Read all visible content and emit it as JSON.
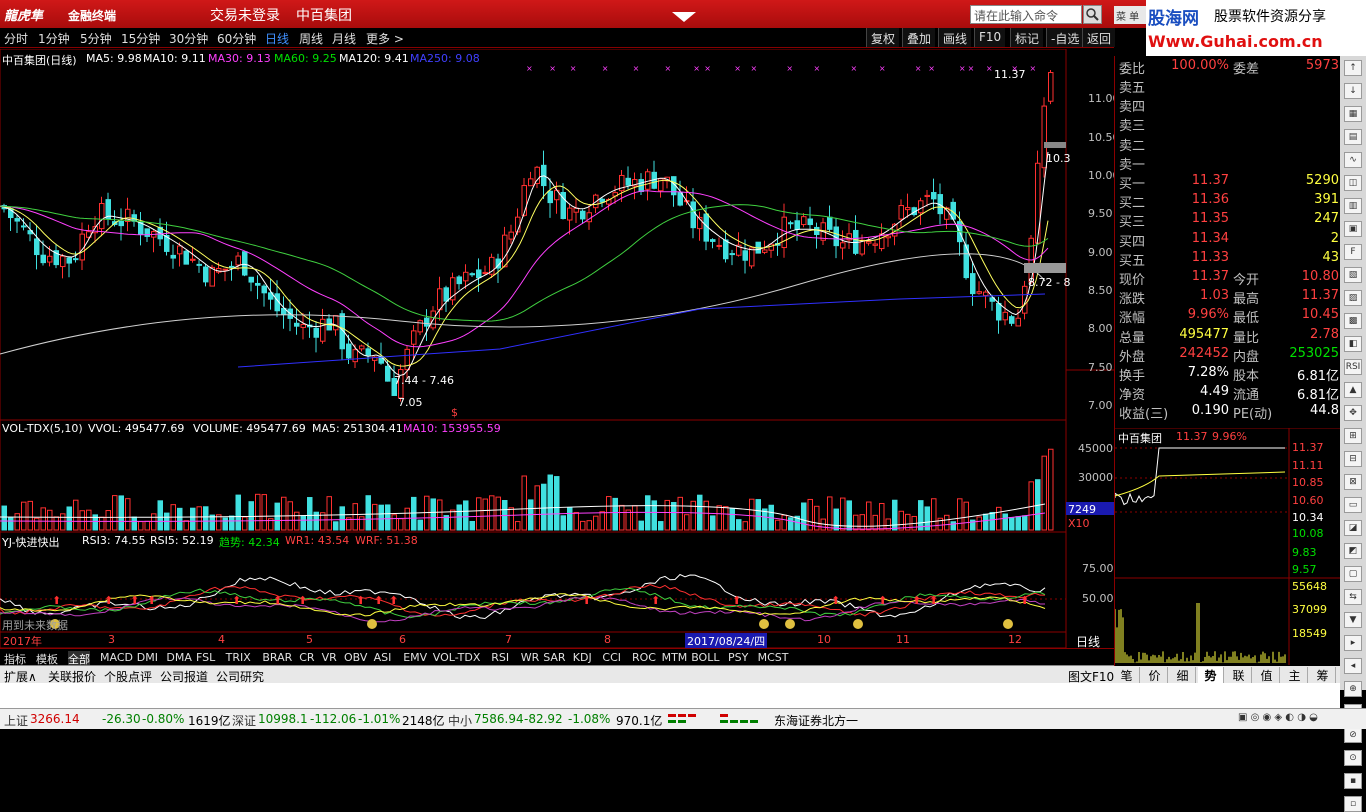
{
  "title": {
    "logo": "龍虎隼",
    "subtitle": "金融终端",
    "trade_status": "交易未登录",
    "stock": "中百集团",
    "command_placeholder": "请在此输入命令",
    "menu_label": "菜 单"
  },
  "watermark": {
    "site": "股海网",
    "tagline": "股票软件资源分享",
    "url": "Www.Guhai.com.cn"
  },
  "periods": [
    "分时",
    "1分钟",
    "5分钟",
    "15分钟",
    "30分钟",
    "60分钟",
    "日线",
    "周线",
    "月线",
    "更多 >"
  ],
  "active_period": "日线",
  "toolbar_right": [
    "复权",
    "叠加",
    "画线",
    "F10",
    "标记",
    "-自选",
    "返回"
  ],
  "main_chart": {
    "header_name": "中百集团(日线)",
    "ma5": "MA5: 9.98",
    "ma10": "MA10: 9.11",
    "ma30": "MA30: 9.13",
    "ma60": "MA60: 9.25",
    "ma120": "MA120: 9.41",
    "ma250": "MA250: 9.08",
    "y_ticks": [
      "11.00",
      "10.50",
      "10.00",
      "9.50",
      "9.00",
      "8.50",
      "8.00",
      "7.50",
      "7.00"
    ],
    "annot_high": "11.37",
    "annot_low1": "7.44 - 7.46",
    "annot_low2": "7.05",
    "annot_right": "8.72 - 8",
    "annot_right2": "10.3",
    "s_mark": "$"
  },
  "volume": {
    "header": "VOL-TDX(5,10)",
    "vvol": "VVOL: 495477.69",
    "volume": "VOLUME: 495477.69",
    "ma5": "MA5: 251304.41",
    "ma10": "MA10: 153955.59",
    "y_ticks": [
      "45000",
      "30000"
    ],
    "readout": "7249",
    "unit": "X10"
  },
  "indicator": {
    "header": "YJ-快进快出",
    "rsi3": "RSI3: 74.55",
    "rsi5": "RSI5: 52.19",
    "trend": "趋势: 42.34",
    "wr1": "WR1: 43.54",
    "wrf": "WRF: 51.38",
    "y_ticks": [
      "75.00",
      "50.00"
    ],
    "note": "用到未来数据"
  },
  "date_axis": {
    "labels": [
      "2017年",
      "3",
      "4",
      "5",
      "6",
      "7",
      "8",
      "10",
      "11",
      "12"
    ],
    "cursor_date": "2017/08/24/四",
    "right_label": "日线",
    "ctrl": [
      "+",
      "-",
      "0"
    ]
  },
  "indicator_tabs": [
    "指标",
    "模板",
    "全部",
    "MACD",
    "DMI",
    "DMA",
    "FSL",
    "TRIX",
    "BRAR",
    "CR",
    "VR",
    "OBV",
    "ASI",
    "EMV",
    "VOL-TDX",
    "RSI",
    "WR",
    "SAR",
    "KDJ",
    "CCI",
    "ROC",
    "MTM",
    "BOLL",
    "PSY",
    "MCST"
  ],
  "bottom_tabs": [
    "扩展∧",
    "关联报价",
    "个股点评",
    "公司报道",
    "公司研究"
  ],
  "bottom_right": "图文F10",
  "right_tabs": [
    "笔",
    "价",
    "细",
    "势",
    "联",
    "值",
    "主",
    "筹"
  ],
  "quote": {
    "ratio_label": "委比",
    "ratio": "100.00%",
    "diff_label": "委差",
    "diff": "5973",
    "asks": [
      {
        "label": "卖五",
        "price": "",
        "vol": ""
      },
      {
        "label": "卖四",
        "price": "",
        "vol": ""
      },
      {
        "label": "卖三",
        "price": "",
        "vol": ""
      },
      {
        "label": "卖二",
        "price": "",
        "vol": ""
      },
      {
        "label": "卖一",
        "price": "",
        "vol": ""
      }
    ],
    "bids": [
      {
        "label": "买一",
        "price": "11.37",
        "vol": "5290"
      },
      {
        "label": "买二",
        "price": "11.36",
        "vol": "391"
      },
      {
        "label": "买三",
        "price": "11.35",
        "vol": "247"
      },
      {
        "label": "买四",
        "price": "11.34",
        "vol": "2"
      },
      {
        "label": "买五",
        "price": "11.33",
        "vol": "43"
      }
    ],
    "stats": [
      {
        "l1": "现价",
        "v1": "11.37",
        "c1": "#ff4040",
        "l2": "今开",
        "v2": "10.80",
        "c2": "#ff4040"
      },
      {
        "l1": "涨跌",
        "v1": "1.03",
        "c1": "#ff4040",
        "l2": "最高",
        "v2": "11.37",
        "c2": "#ff4040"
      },
      {
        "l1": "涨幅",
        "v1": "9.96%",
        "c1": "#ff4040",
        "l2": "最低",
        "v2": "10.45",
        "c2": "#ff4040"
      },
      {
        "l1": "总量",
        "v1": "495477",
        "c1": "#ffff40",
        "l2": "量比",
        "v2": "2.78",
        "c2": "#ff4040"
      },
      {
        "l1": "外盘",
        "v1": "242452",
        "c1": "#ff4040",
        "l2": "内盘",
        "v2": "253025",
        "c2": "#00e000"
      }
    ],
    "stats2": [
      {
        "l1": "换手",
        "v1": "7.28%",
        "l2": "股本",
        "v2": "6.81亿"
      },
      {
        "l1": "净资",
        "v1": "4.49",
        "l2": "流通",
        "v2": "6.81亿"
      },
      {
        "l1": "收益(三)",
        "v1": "0.190",
        "l2": "PE(动)",
        "v2": "44.8"
      }
    ]
  },
  "mini_chart": {
    "name": "中百集团",
    "price": "11.37",
    "pct": "9.96%",
    "y_ticks": [
      "11.37",
      "11.11",
      "10.85",
      "10.60",
      "10.34",
      "10.08",
      "9.83",
      "9.57"
    ],
    "vol_ticks": [
      "55648",
      "37099",
      "18549"
    ]
  },
  "status_bar": {
    "sh_label": "上证",
    "sh_val": "3266.14",
    "sh_chg": "-26.30",
    "sh_pct": "-0.80%",
    "sh_amt": "1619亿",
    "sz_label": "深证",
    "sz_val": "10998.1",
    "sz_chg": "-112.06",
    "sz_pct": "-1.01%",
    "sz_amt": "2148亿",
    "zx_label": "中小",
    "zx_val": "7586.94",
    "zx_chg": "-82.92",
    "zx_pct": "-1.08%",
    "zx_amt": "970.1亿",
    "broker": "东海证券北方一"
  }
}
